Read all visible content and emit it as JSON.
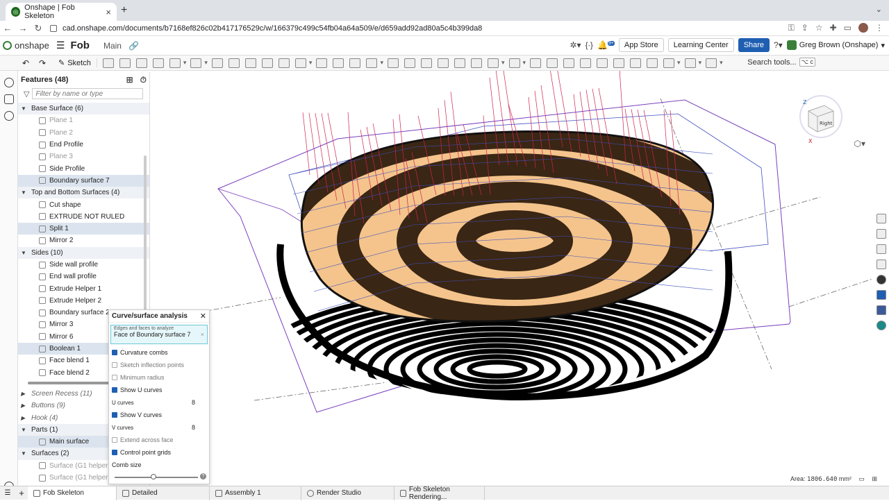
{
  "browser": {
    "tab_title": "Onshape | Fob Skeleton",
    "url": "cad.onshape.com/documents/b7168ef826c02b417176529c/w/166379c499c54fb04a64a509/e/d659add92ad80a5c4b399da8"
  },
  "header": {
    "logo": "onshape",
    "doc_name": "Fob",
    "branch": "Main",
    "app_store": "App Store",
    "learning_center": "Learning Center",
    "share": "Share",
    "user": "Greg Brown (Onshape)",
    "notif_badge": "9+"
  },
  "toolbar": {
    "sketch": "Sketch",
    "search_tools": "Search tools...",
    "search_kbd": "⌥ c"
  },
  "features": {
    "title": "Features (48)",
    "filter_placeholder": "Filter by name or type",
    "items": [
      {
        "label": "Base Surface (6)",
        "kind": "folder"
      },
      {
        "label": "Plane 1",
        "kind": "muted"
      },
      {
        "label": "Plane 2",
        "kind": "muted"
      },
      {
        "label": "End Profile",
        "kind": "item"
      },
      {
        "label": "Plane 3",
        "kind": "muted"
      },
      {
        "label": "Side Profile",
        "kind": "item"
      },
      {
        "label": "Boundary surface 7",
        "kind": "sel"
      },
      {
        "label": "Top and Bottom Surfaces (4)",
        "kind": "folder"
      },
      {
        "label": "Cut shape",
        "kind": "item"
      },
      {
        "label": "EXTRUDE NOT RULED",
        "kind": "item"
      },
      {
        "label": "Split 1",
        "kind": "sel"
      },
      {
        "label": "Mirror 2",
        "kind": "item"
      },
      {
        "label": "Sides (10)",
        "kind": "folder"
      },
      {
        "label": "Side wall profile",
        "kind": "item"
      },
      {
        "label": "End wall profile",
        "kind": "item"
      },
      {
        "label": "Extrude Helper 1",
        "kind": "item"
      },
      {
        "label": "Extrude Helper 2",
        "kind": "item"
      },
      {
        "label": "Boundary surface 2",
        "kind": "item"
      },
      {
        "label": "Mirror 3",
        "kind": "item"
      },
      {
        "label": "Mirror 6",
        "kind": "item"
      },
      {
        "label": "Boolean 1",
        "kind": "sel"
      },
      {
        "label": "Face blend 1",
        "kind": "item"
      },
      {
        "label": "Face blend 2",
        "kind": "item"
      }
    ],
    "lower": [
      {
        "label": "Screen Recess (11)",
        "kind": "collapsed"
      },
      {
        "label": "Buttons (9)",
        "kind": "collapsed"
      },
      {
        "label": "Hook (4)",
        "kind": "collapsed"
      },
      {
        "label": "Parts (1)",
        "kind": "folder"
      },
      {
        "label": "Main surface",
        "kind": "sel"
      },
      {
        "label": "Surfaces (2)",
        "kind": "folder"
      },
      {
        "label": "Surface (G1 helper) 1",
        "kind": "muted"
      },
      {
        "label": "Surface (G1 helper) 2",
        "kind": "muted"
      }
    ]
  },
  "analysis": {
    "title": "Curve/surface analysis",
    "sel_label": "Edges and faces to analyze",
    "sel_value": "Face of Boundary surface 7",
    "curvature_combs": "Curvature combs",
    "sketch_inflection": "Sketch inflection points",
    "minimum_radius": "Minimum radius",
    "show_u": "Show U curves",
    "u_label": "U curves",
    "u_value": "8",
    "show_v": "Show V curves",
    "v_label": "V curves",
    "v_value": "8",
    "extend": "Extend across face",
    "control_grids": "Control point grids",
    "comb_size": "Comb size"
  },
  "viewport": {
    "cube_label": "Right",
    "area_label": "Area:",
    "area_value": "1806.640",
    "area_unit": "mm²"
  },
  "tabs": [
    {
      "label": "Fob Skeleton"
    },
    {
      "label": "Detailed"
    },
    {
      "label": "Assembly 1"
    },
    {
      "label": "Render Studio"
    },
    {
      "label": "Fob Skeleton Rendering..."
    }
  ],
  "colors": {
    "share": "#1f5fb2",
    "surface": "#f4c48c",
    "stripe": "#3a2614",
    "comb": "#d02050",
    "grid": "#7a3fbf"
  }
}
